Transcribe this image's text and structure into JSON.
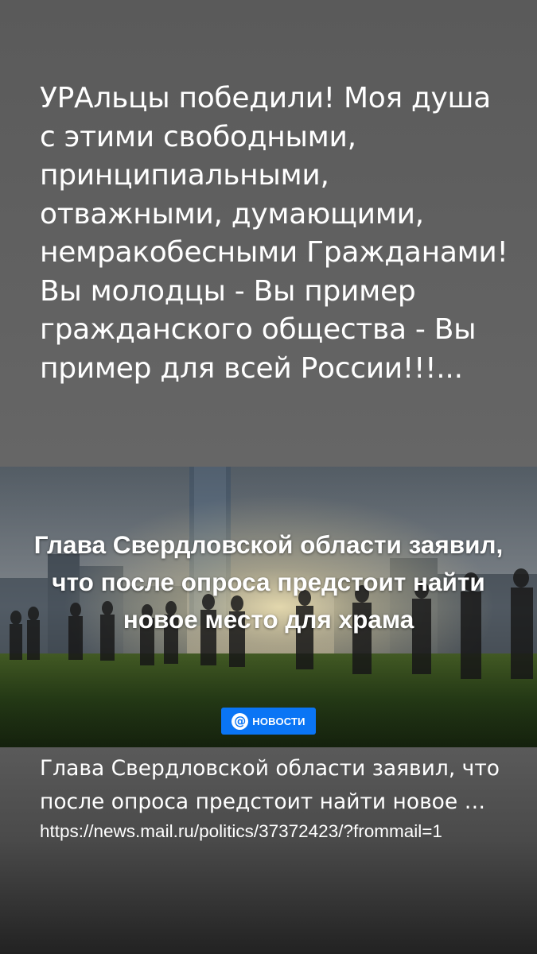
{
  "post": {
    "text": "УРАльцы победили! Моя душа с этими свободными, принципиальными, отважными, думающими, немракобесными Гражданами! Вы молодцы - Вы пример гражданского общества - Вы пример для всей России!!!..."
  },
  "link_preview": {
    "image_headline": "Глава Свердловской области заявил, что после опроса предстоит найти новое место для храма",
    "source_badge": {
      "icon": "at-icon",
      "label": "НОВОСТИ",
      "color": "#0a75f5"
    },
    "title": "Глава Свердловской области заявил, что после опроса предстоит найти новое место для храма",
    "url": "https://news.mail.ru/politics/37372423/?frommail=1"
  },
  "colors": {
    "background": "#656565",
    "text": "#ffffff",
    "badge": "#0a75f5"
  }
}
